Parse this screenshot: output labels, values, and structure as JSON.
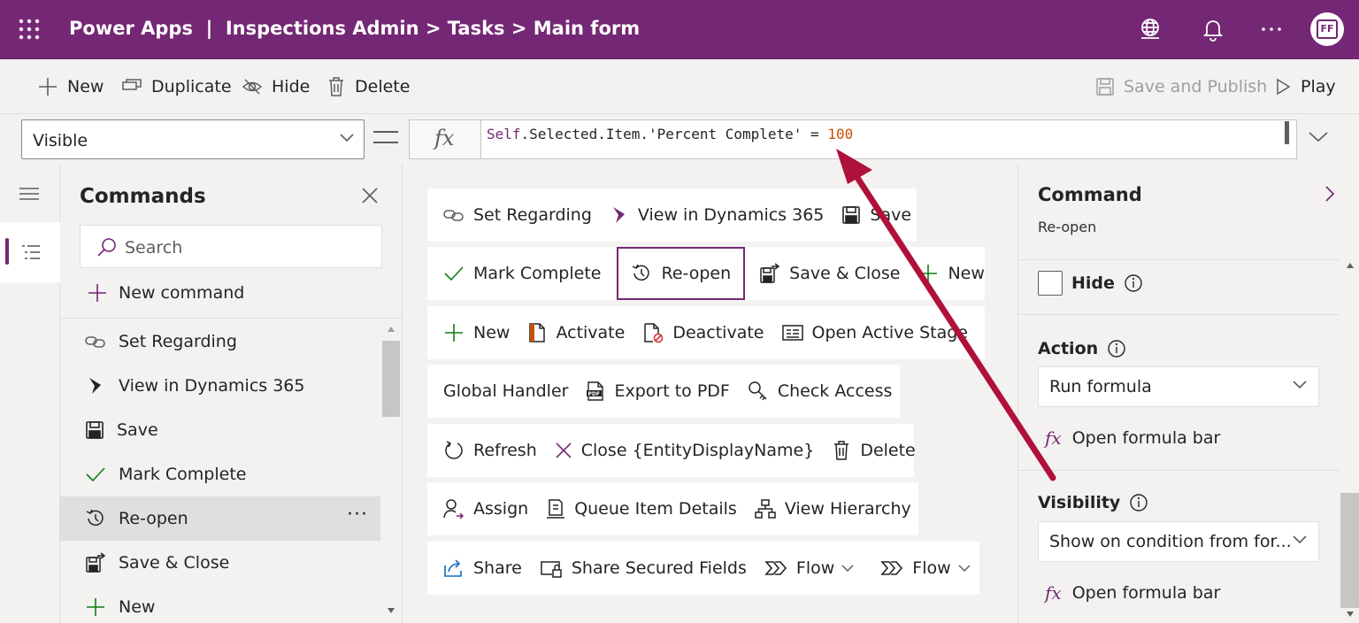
{
  "app": {
    "title": "Power Apps  |  Inspections Admin > Tasks > Main form",
    "avatar_initials": "FF",
    "accent_color": "#742774"
  },
  "toolbar": {
    "new_label": "New",
    "duplicate_label": "Duplicate",
    "hide_label": "Hide",
    "delete_label": "Delete",
    "save_publish_label": "Save and Publish",
    "play_label": "Play"
  },
  "formula_bar": {
    "property": "Visible",
    "fx_label": "fx",
    "formula_self": "Self",
    "formula_middle": ".Selected.Item.'Percent Complete' = ",
    "formula_number": "100"
  },
  "commands_panel": {
    "heading": "Commands",
    "search_placeholder": "Search",
    "new_command_label": "New command",
    "items": [
      {
        "label": "Set Regarding",
        "icon": "link-icon"
      },
      {
        "label": "View in Dynamics 365",
        "icon": "dynamics-icon"
      },
      {
        "label": "Save",
        "icon": "save-icon"
      },
      {
        "label": "Mark Complete",
        "icon": "checkmark-icon"
      },
      {
        "label": "Re-open",
        "icon": "history-icon",
        "selected": true,
        "more": "···"
      },
      {
        "label": "Save & Close",
        "icon": "save-close-icon"
      },
      {
        "label": "New",
        "icon": "plus-icon"
      }
    ]
  },
  "canvas": {
    "rows": [
      [
        "Set Regarding",
        "View in Dynamics 365",
        "Save"
      ],
      [
        "Mark Complete",
        "Re-open",
        "Save & Close",
        "New"
      ],
      [
        "New",
        "Activate",
        "Deactivate",
        "Open Active Stage"
      ],
      [
        "Global Handler",
        "Export to PDF",
        "Check Access"
      ],
      [
        "Refresh",
        "Close {EntityDisplayName}",
        "Delete"
      ],
      [
        "Assign",
        "Queue Item Details",
        "View Hierarchy"
      ],
      [
        "Share",
        "Share Secured Fields",
        "Flow",
        "Flow"
      ]
    ]
  },
  "right_pane": {
    "heading": "Command",
    "subtitle": "Re-open",
    "hide_label": "Hide",
    "action_label": "Action",
    "action_value": "Run formula",
    "open_formula_label": "Open formula bar",
    "visibility_label": "Visibility",
    "visibility_value": "Show on condition from for...",
    "open_formula_label_2": "Open formula bar",
    "fx_label": "fx"
  }
}
